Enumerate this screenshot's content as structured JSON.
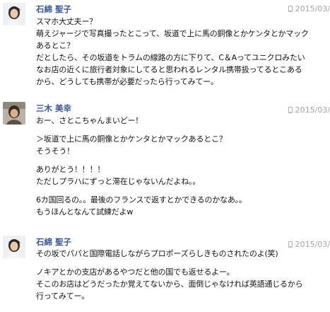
{
  "comments": [
    {
      "author": "石綿 聖子",
      "timestamp": "2015/03/",
      "via_icon": "mobile-phone-icon",
      "avatar_icon": "user-avatar-photo",
      "paragraphs": [
        [
          "スマホ大丈夫ー？",
          "萌えジャージで写真撮ったとこって、坂道で上に馬の銅像とかケンタとかマック",
          "あるとこ？",
          "だとしたら、その坂道をトラムの線路の方に下りて、C＆Aってユニクロみたい",
          "なお店の近くに旅行者対象にしてると思われるレンタル携帯扱ってるとこある",
          "から、どうしても携帯が必要だったら行ってみてー。"
        ]
      ]
    },
    {
      "author": "三木 美幸",
      "timestamp": "2015/03/",
      "via_icon": "mobile-phone-icon",
      "avatar_icon": "user-avatar-photo",
      "paragraphs": [
        [
          "おー、さとこちゃんまいどー！"
        ],
        [
          "＞坂道で上に馬の銅像とかケンタとかマックあるとこ？",
          "そうそう！"
        ],
        [
          "ありがとう！！！！",
          "ただしプラハにずっと滞在じゃないんだよね。。"
        ],
        [
          "6カ国回るの。。最後のフランスで返すとかできるのかなあ。。",
          "もうほんとなんて試練だよw"
        ]
      ]
    },
    {
      "author": "石綿 聖子",
      "timestamp": "2015/03/",
      "via_icon": "mobile-phone-icon",
      "avatar_icon": "user-avatar-photo",
      "paragraphs": [
        [
          "その坂でパパと国際電話しながらプロポーズらしきものされたのよ(笑)"
        ],
        [
          "ノキアとかの支店があるやつだと他の国でも返せるよー。",
          "そこのお店はどうだったか覚えてないから、面倒じゃなければ英語通じるから",
          "行ってみてー。"
        ]
      ]
    }
  ]
}
